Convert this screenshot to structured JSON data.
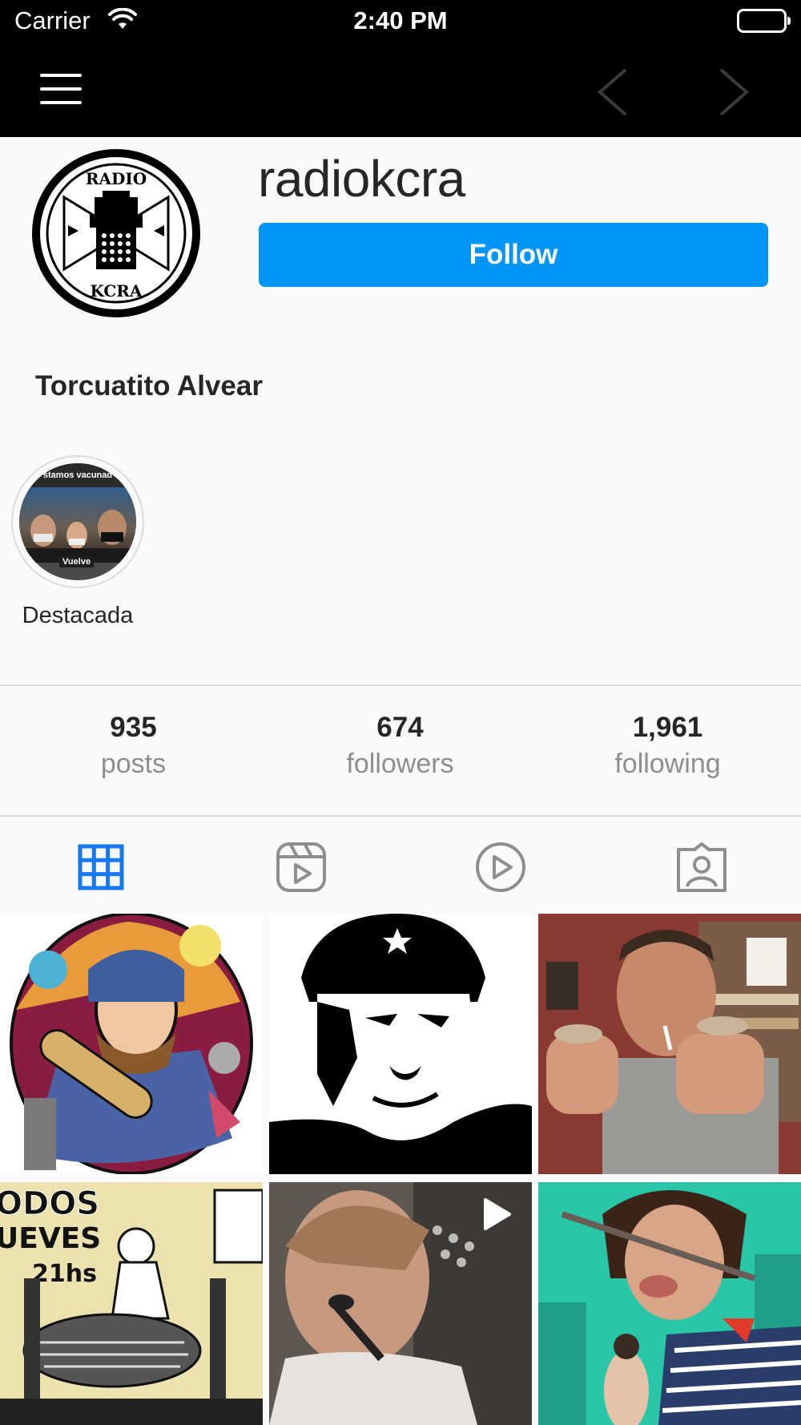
{
  "status_bar": {
    "carrier": "Carrier",
    "time": "2:40 PM"
  },
  "nav": {
    "menu_icon": "hamburger-icon",
    "back_icon": "chevron-left-icon",
    "forward_icon": "chevron-right-icon"
  },
  "profile": {
    "username": "radiokcra",
    "follow_label": "Follow",
    "full_name": "Torcuatito Alvear",
    "avatar_text_top": "RADIO",
    "avatar_text_bottom": "KCRA"
  },
  "highlights": [
    {
      "label": "Destacada",
      "cover_text_top": "stamos vacunad",
      "cover_text_bottom": "Vuelve"
    }
  ],
  "stats": {
    "posts": {
      "value": "935",
      "label": "posts"
    },
    "followers": {
      "value": "674",
      "label": "followers"
    },
    "following": {
      "value": "1,961",
      "label": "following"
    }
  },
  "tabs": [
    {
      "name": "grid-tab",
      "icon": "grid-icon",
      "active": true
    },
    {
      "name": "reels-tab",
      "icon": "reels-icon",
      "active": false
    },
    {
      "name": "video-tab",
      "icon": "play-circle-icon",
      "active": false
    },
    {
      "name": "tagged-tab",
      "icon": "tagged-person-icon",
      "active": false
    }
  ],
  "colors": {
    "accent": "#0095f6",
    "active_tab": "#1877f2",
    "inactive_tab": "#8e8e8e"
  }
}
